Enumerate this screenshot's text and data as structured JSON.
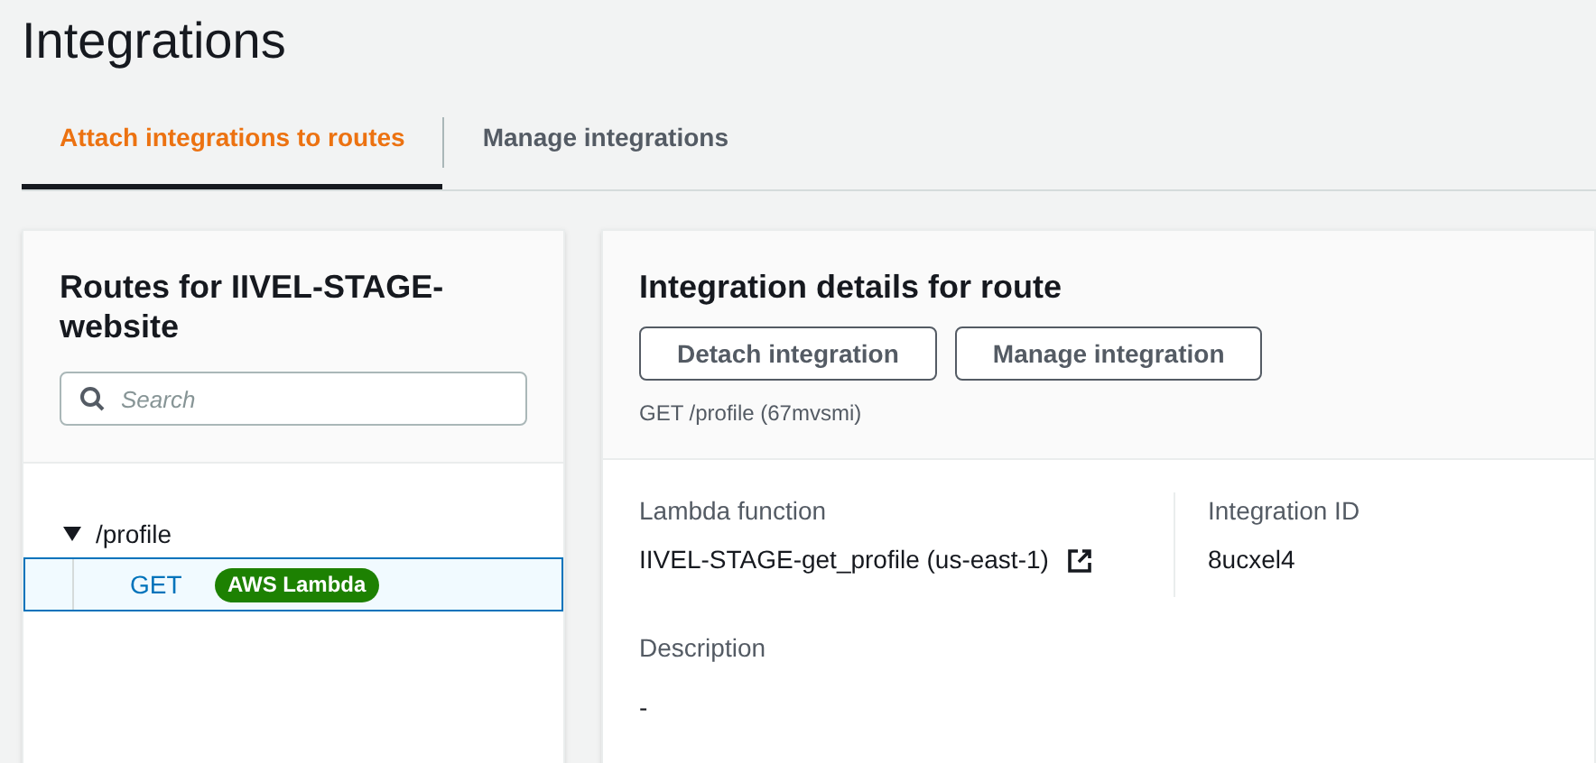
{
  "page_title": "Integrations",
  "tabs": [
    {
      "label": "Attach integrations to routes",
      "selected": true
    },
    {
      "label": "Manage integrations",
      "selected": false
    }
  ],
  "routes_panel": {
    "title": "Routes for IIVEL-STAGE-website",
    "search": {
      "placeholder": "Search"
    },
    "tree": [
      {
        "label": "/profile",
        "expanded": true,
        "children": [
          {
            "method": "GET",
            "badge": "AWS Lambda",
            "selected": true
          }
        ]
      }
    ]
  },
  "details_panel": {
    "title": "Integration details for route",
    "buttons": [
      "Detach integration",
      "Manage integration"
    ],
    "route": "GET /profile (67mvsmi)",
    "fields": [
      {
        "label": "Lambda function",
        "value": "IIVEL-STAGE-get_profile (us-east-1)",
        "external_link": true
      },
      {
        "label": "Integration ID",
        "value": "8ucxel4",
        "external_link": false
      },
      {
        "label": "Description",
        "value": "-",
        "external_link": false
      }
    ]
  }
}
